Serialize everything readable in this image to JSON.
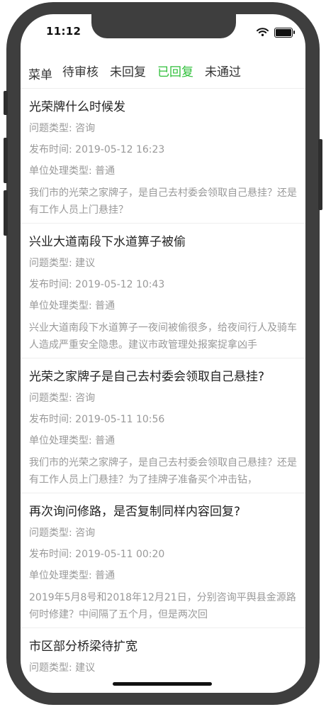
{
  "status_bar": {
    "time": "11:12"
  },
  "tabbar": {
    "menu_label": "菜单",
    "tabs": [
      {
        "label": "待审核"
      },
      {
        "label": "未回复"
      },
      {
        "label": "已回复",
        "active": true
      },
      {
        "label": "未通过"
      }
    ],
    "active_color": "#2fbf3a"
  },
  "items": [
    {
      "title": "光荣牌什么时候发",
      "type": "问题类型: 咨询",
      "published": "发布时间: 2019-05-12 16:23",
      "handling": "单位处理类型: 普通",
      "desc": "我们市的光荣之家牌子，是自己去村委会领取自己悬挂？还是有工作人员上门悬挂？"
    },
    {
      "title": "兴业大道南段下水道箅子被偷",
      "type": "问题类型: 建议",
      "published": "发布时间: 2019-05-12 10:43",
      "handling": "单位处理类型: 普通",
      "desc": "兴业大道南段下水道箅子一夜间被偷很多，给夜间行人及骑车人造成严重安全隐患。建议市政管理处报案捉拿凶手"
    },
    {
      "title": "光荣之家牌子是自己去村委会领取自己悬挂?",
      "type": "问题类型: 咨询",
      "published": "发布时间: 2019-05-11 10:56",
      "handling": "单位处理类型: 普通",
      "desc": "我们市的光荣之家牌子，是自己去村委会领取自己悬挂？还是有工作人员上门悬挂？为了挂牌子准备买个冲击钻，"
    },
    {
      "title": "再次询问修路，是否复制同样内容回复?",
      "type": "问题类型: 咨询",
      "published": "发布时间: 2019-05-11 00:20",
      "handling": "单位处理类型: 普通",
      "desc": "2019年5月8号和2018年12月21日，分别咨询平舆县金源路何时修建？中间隔了五个月，但是两次回"
    },
    {
      "title": "市区部分桥梁待扩宽",
      "type": "问题类型: 建议"
    }
  ]
}
